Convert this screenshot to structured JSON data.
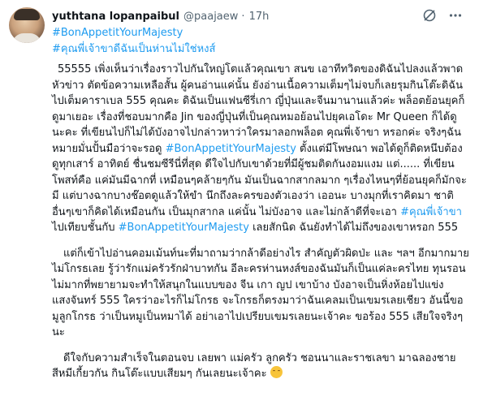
{
  "author": {
    "name": "yuthtana lopanpaibul",
    "handle": "@paajaew",
    "sep": "·",
    "time": "17h"
  },
  "icons": {
    "grok": "grok-icon",
    "more": "more-icon"
  },
  "tweet": {
    "hashtag1": "#BonAppetitYourMajesty",
    "hashtag2": "#คุณพี่เจ้าขาดีฉันเป็นห่านไม่ใช่หงส์",
    "p1_a": "55555 เพิ่งเห็นว่าเรื่องราวไปกันใหญ่โตแล้วคุณเขา  สนข เอาทีทวิตของดิฉันไปลงแล้วพาดหัวข่าว  ตัดข้อความเหลือสั้น  ผู้คนอ่านแค่นั้น ยังอ่านเนื้อความเต็มๆไม่จบก็เลยรุมกินโต๊ะดิฉันไปเต็มคาราเบล    555 คุณคะ ดิฉันเป็นแฟนซีรี่เกา ญี่ปุ่นและจีนมานานแล้วค่ะ  พล็อตย้อนยุคก็ดูมาเยอะ เรื่องที่ชอบมากคือ Jin ของญี่ปุ่นที่เป็นคุณหมอย้อนไปยุคเอโดะ  Mr Queen ก็ได้ดูนะคะ  ที่เขียนไปก็ไม่ได้บังอาจไปกล่าวหาว่าใครมาลอกพล็อต คุณพี่เจ้าขา  หรอกค่ะ  จริงๆฉันหมายมั่นปั้นมือว่าจะรอดู ",
    "p1_link1": "#BonAppetitYourMajesty",
    "p1_b": " ตั้งแต่มีโพษณา พอได้ดูก็ติดหนึบต้องดูทุกเสาร์ อาทิตย์ ชื่นชมซีรีนี่ที่สุด ดีใจไปกับเขาด้วยที่มีผู้ชมติดกันงอมแงม   แต่...... ที่เขียนโพสท์คือ แค่มันมีฉากที่ เหมือนๆคล้ายๆกัน มันเป็นฉากสากลมาก ๆเรื่องไหนๆที่ย้อนยุคก็มักจะมี แต่บางฉากบางช๊อตดูแล้วให้ขำ นึกถึงละครของตัวเองว่า  เออนะ  บางมุกที่เราคิดมา ชาติอื่นๆเขาก็คิดได้เหมือนกัน เป็นมุกสากล แค่นั้น  ไม่บังอาจ และไม่กล้าดีที่จะเอา ",
    "p1_link2": "#คุณพี่เจ้าขา",
    "p1_c": " ไปเทียบชั้นกับ ",
    "p1_link3": "#BonAppetitYourMajesty",
    "p1_d": " เลยสักนิด  ฉันยังทำได้ไม่ถึงของเขาหรอก 555",
    "p2": "แต่ก็เข้าไปอ่านคอมเม้นท์นะที่มาถามว่ากล้าดีอย่างไร สำคัญตัวผิดป่ะ และ ฯลฯ อีกมากมาย  ไม่โกรธเลย รู้ว่ารักแม่ครัวรักฝ่าบาทกัน อีละครห่านหงส์ของฉันมันก็เป็นแค่ละครไทย ทุนรอนไม่มากที่พยายามจะทำให้สนุกในแบบของ จีน เกา ญป เขาบ้าง บังอาจเป็นหิ่งห้อยไปแข่งแสงจันทร์ 555 ใครว่าอะไรก็ไม่โกรธ   จะโกรธก็ตรงมาว่าฉันเคลมเป็นเขมรเลยเชียว  อันนี้ขอมูลูกโกรธ ว่าเป็นหมูเป็นหมาได้  อย่าเอาไปเปรียบเขมรเลยนะเจ้าคะ ขอร้อง 555 เสียใจจริงๆนะ",
    "p3": "ดีใจกับความสำเร็จในตอนจบ เลยพา แม่ครัว ลูกครัว  ชอนนาและราชเลขา มาฉลองชายสีหมีเกี้ยวกัน  กินโต๊ะแบบเสียมๆ กันเลยนะเจ้าคะ "
  }
}
